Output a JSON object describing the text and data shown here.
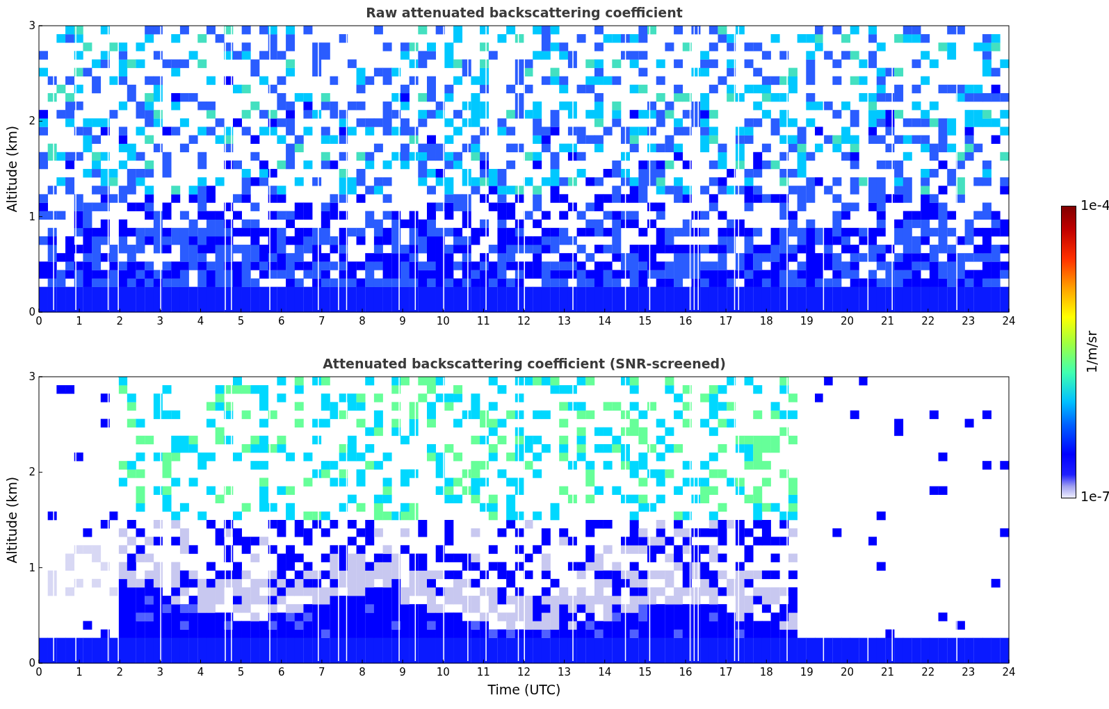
{
  "panels": [
    {
      "kind": "raw",
      "title": "Raw attenuated backscattering coefficient",
      "ylabel": "Altitude (km)",
      "yticks": [
        "3",
        "2",
        "1",
        "0"
      ],
      "xticks": [
        "0",
        "1",
        "2",
        "3",
        "4",
        "5",
        "6",
        "7",
        "8",
        "9",
        "10",
        "11",
        "12",
        "13",
        "14",
        "15",
        "16",
        "17",
        "18",
        "19",
        "20",
        "21",
        "22",
        "23",
        "24"
      ]
    },
    {
      "kind": "screened",
      "title": "Attenuated backscattering coefficient (SNR-screened)",
      "ylabel": "Altitude (km)",
      "yticks": [
        "3",
        "2",
        "1",
        "0"
      ],
      "xticks": [
        "0",
        "1",
        "2",
        "3",
        "4",
        "5",
        "6",
        "7",
        "8",
        "9",
        "10",
        "11",
        "12",
        "13",
        "14",
        "15",
        "16",
        "17",
        "18",
        "19",
        "20",
        "21",
        "22",
        "23",
        "24"
      ]
    }
  ],
  "xlabel": "Time (UTC)",
  "colorbar": {
    "label": "1/m/sr",
    "top": "1e-4",
    "bottom": "1e-7"
  }
}
